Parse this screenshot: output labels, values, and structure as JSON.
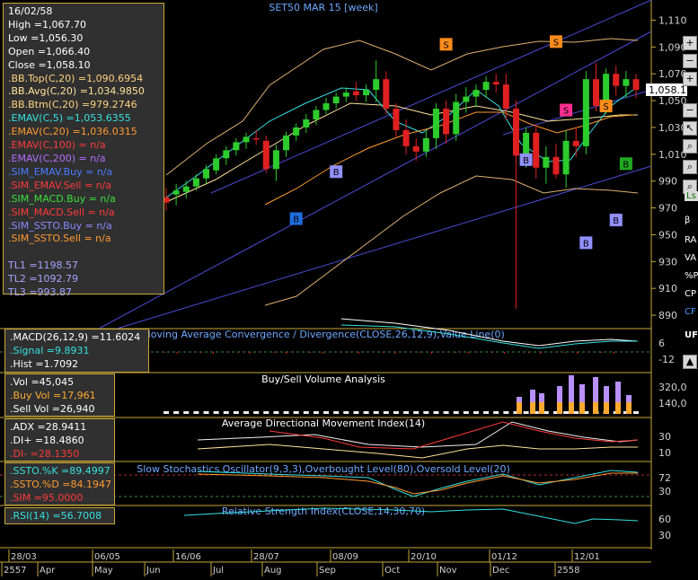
{
  "title": "SET50 MAR 15  [week]",
  "chart_data": {
    "type": "candlestick",
    "title": "SET50 MAR 15  [week]",
    "x_labels": [
      "28/03",
      "06/05",
      "16/06",
      "28/07",
      "08/09",
      "20/10",
      "01/12",
      "12/01"
    ],
    "month_labels": [
      "2557",
      "Apr",
      "May",
      "Jun",
      "Jul",
      "Aug",
      "Sep",
      "Oct",
      "Nov",
      "Dec",
      "2558"
    ],
    "y_ticks": [
      1110,
      1090,
      1070,
      1050,
      1030,
      1010,
      990,
      970,
      950,
      930,
      910,
      890
    ],
    "ylim": [
      880,
      1117
    ],
    "current_price": "1,058.1",
    "candles": [
      {
        "o": 978,
        "h": 985,
        "l": 968,
        "c": 974
      },
      {
        "o": 980,
        "h": 988,
        "l": 972,
        "c": 983
      },
      {
        "o": 982,
        "h": 990,
        "l": 977,
        "c": 986
      },
      {
        "o": 986,
        "h": 995,
        "l": 983,
        "c": 992
      },
      {
        "o": 992,
        "h": 1002,
        "l": 988,
        "c": 999
      },
      {
        "o": 998,
        "h": 1010,
        "l": 995,
        "c": 1007
      },
      {
        "o": 1007,
        "h": 1016,
        "l": 1002,
        "c": 1013
      },
      {
        "o": 1013,
        "h": 1022,
        "l": 1009,
        "c": 1019
      },
      {
        "o": 1019,
        "h": 1026,
        "l": 1014,
        "c": 1023
      },
      {
        "o": 1022,
        "h": 1028,
        "l": 1017,
        "c": 1021
      },
      {
        "o": 1020,
        "h": 1024,
        "l": 996,
        "c": 999
      },
      {
        "o": 999,
        "h": 1017,
        "l": 990,
        "c": 1013
      },
      {
        "o": 1013,
        "h": 1027,
        "l": 1008,
        "c": 1024
      },
      {
        "o": 1024,
        "h": 1033,
        "l": 1020,
        "c": 1030
      },
      {
        "o": 1030,
        "h": 1040,
        "l": 1026,
        "c": 1036
      },
      {
        "o": 1036,
        "h": 1046,
        "l": 1032,
        "c": 1043
      },
      {
        "o": 1043,
        "h": 1052,
        "l": 1040,
        "c": 1048
      },
      {
        "o": 1048,
        "h": 1056,
        "l": 1044,
        "c": 1053
      },
      {
        "o": 1053,
        "h": 1060,
        "l": 1049,
        "c": 1056
      },
      {
        "o": 1057,
        "h": 1064,
        "l": 1050,
        "c": 1054
      },
      {
        "o": 1054,
        "h": 1062,
        "l": 1049,
        "c": 1058
      },
      {
        "o": 1058,
        "h": 1080,
        "l": 1049,
        "c": 1066
      },
      {
        "o": 1066,
        "h": 1072,
        "l": 1040,
        "c": 1044
      },
      {
        "o": 1044,
        "h": 1048,
        "l": 1023,
        "c": 1028
      },
      {
        "o": 1028,
        "h": 1036,
        "l": 1010,
        "c": 1016
      },
      {
        "o": 1016,
        "h": 1022,
        "l": 1005,
        "c": 1012
      },
      {
        "o": 1012,
        "h": 1028,
        "l": 1008,
        "c": 1022
      },
      {
        "o": 1022,
        "h": 1048,
        "l": 1014,
        "c": 1044
      },
      {
        "o": 1044,
        "h": 1050,
        "l": 1018,
        "c": 1025
      },
      {
        "o": 1025,
        "h": 1055,
        "l": 1020,
        "c": 1049
      },
      {
        "o": 1049,
        "h": 1060,
        "l": 1041,
        "c": 1053
      },
      {
        "o": 1053,
        "h": 1062,
        "l": 1045,
        "c": 1058
      },
      {
        "o": 1058,
        "h": 1068,
        "l": 1053,
        "c": 1064
      },
      {
        "o": 1064,
        "h": 1070,
        "l": 1056,
        "c": 1062
      },
      {
        "o": 1062,
        "h": 1070,
        "l": 1036,
        "c": 1044
      },
      {
        "o": 1044,
        "h": 1050,
        "l": 895,
        "c": 1009
      },
      {
        "o": 1009,
        "h": 1030,
        "l": 1000,
        "c": 1026
      },
      {
        "o": 1026,
        "h": 1032,
        "l": 992,
        "c": 1000
      },
      {
        "o": 1000,
        "h": 1016,
        "l": 988,
        "c": 1008
      },
      {
        "o": 1008,
        "h": 1018,
        "l": 992,
        "c": 995
      },
      {
        "o": 995,
        "h": 1028,
        "l": 985,
        "c": 1020
      },
      {
        "o": 1020,
        "h": 1030,
        "l": 1008,
        "c": 1016
      },
      {
        "o": 1016,
        "h": 1072,
        "l": 1010,
        "c": 1066
      },
      {
        "o": 1066,
        "h": 1078,
        "l": 1042,
        "c": 1046
      },
      {
        "o": 1046,
        "h": 1074,
        "l": 1040,
        "c": 1070
      },
      {
        "o": 1070,
        "h": 1076,
        "l": 1054,
        "c": 1061
      },
      {
        "o": 1061,
        "h": 1072,
        "l": 1052,
        "c": 1066
      },
      {
        "o": 1066,
        "h": 1070,
        "l": 1052,
        "c": 1058
      }
    ],
    "signals": [
      {
        "i": 13,
        "label": "B",
        "price": 962,
        "color": "#1e6fe0"
      },
      {
        "i": 17,
        "label": "B",
        "price": 997,
        "color": "#9090ff"
      },
      {
        "i": 28,
        "label": "S",
        "price": 1092,
        "color": "#ff8c1a"
      },
      {
        "i": 36,
        "label": "B",
        "price": 1006,
        "color": "#9090ff"
      },
      {
        "i": 39,
        "label": "S",
        "price": 1094,
        "color": "#ff8c1a"
      },
      {
        "i": 40,
        "label": "S",
        "price": 1043,
        "color": "#ff3090"
      },
      {
        "i": 42,
        "label": "B",
        "price": 944,
        "color": "#9090ff"
      },
      {
        "i": 44,
        "label": "S",
        "price": 1046,
        "color": "#ff8c1a"
      },
      {
        "i": 45,
        "label": "B",
        "price": 961,
        "color": "#9090ff"
      },
      {
        "i": 46,
        "label": "B",
        "price": 1003,
        "color": "#1faa1f"
      }
    ]
  },
  "info_main": [
    {
      "text": "16/02/58",
      "color": "#ffffff"
    },
    {
      "text": "High  =1,067.70",
      "color": "#ffffff"
    },
    {
      "text": "Low  =1,056.30",
      "color": "#ffffff"
    },
    {
      "text": "Open  =1,066.40",
      "color": "#ffffff"
    },
    {
      "text": "Close  =1,058.10",
      "color": "#ffffff"
    },
    {
      "text": ".BB.Top(C,20)  =1,090.6954",
      "color": "#ffd27f"
    },
    {
      "text": ".BB.Avg(C,20)  =1,034.9850",
      "color": "#ffe39a"
    },
    {
      "text": ".BB.Btm(C,20)  =979.2746",
      "color": "#ffd27f"
    },
    {
      "text": ".EMAV(C,5)  =1,053.6355",
      "color": "#36e0e0"
    },
    {
      "text": ".EMAV(C,20)  =1,036.0315",
      "color": "#ff9a30"
    },
    {
      "text": ".EMAV(C,100)  = n/a",
      "color": "#ff3a3a"
    },
    {
      "text": ".EMAV(C,200)  = n/a",
      "color": "#b46cff"
    },
    {
      "text": ".SIM_EMAV.Buy  = n/a",
      "color": "#4a7bff"
    },
    {
      "text": ".SIM_EMAV.Sell  = n/a",
      "color": "#ff3a3a"
    },
    {
      "text": ".SIM_MACD.Buy  = n/a",
      "color": "#39e039"
    },
    {
      "text": ".SIM_MACD.Sell  = n/a",
      "color": "#ff3a3a"
    },
    {
      "text": ".SIM_SSTO.Buy  = n/a",
      "color": "#8a8aff"
    },
    {
      "text": ".SIM_SSTO.Sell  = n/a",
      "color": "#ff9a30"
    },
    {
      "text": "",
      "color": "#ffffff"
    },
    {
      "text": "TL1 =1198.57",
      "color": "#a4a4ff"
    },
    {
      "text": "TL2 =1092.79",
      "color": "#a4a4ff"
    },
    {
      "text": "TL3 =993.87",
      "color": "#a4a4ff"
    }
  ],
  "macd": {
    "title": "Moving Average Convergence / Divergence(CLOSE,26,12,9),Value Line(0)",
    "rows": [
      {
        "text": ".MACD(26,12,9)  =11.6024",
        "color": "#ffffff"
      },
      {
        "text": ".Signal  =9.8931",
        "color": "#36e0e0"
      },
      {
        "text": ".Hist  =1.7092",
        "color": "#ffffff"
      }
    ],
    "ticks": [
      {
        "v": "6"
      },
      {
        "v": "-12"
      }
    ]
  },
  "volume": {
    "title": "Buy/Sell Volume Analysis",
    "rows": [
      {
        "text": ".Vol  =45,045",
        "color": "#ffffff"
      },
      {
        "text": ".Buy Vol  =17,961",
        "color": "#ffaa30"
      },
      {
        "text": ".Sell Vol  =26,940",
        "color": "#ffffff"
      }
    ],
    "ticks": [
      {
        "v": "320,0"
      },
      {
        "v": "140,0"
      }
    ]
  },
  "adx": {
    "title": "Average Directional Movement Index(14)",
    "rows": [
      {
        "text": ".ADX  =28.9411",
        "color": "#ffffff"
      },
      {
        "text": ".DI+  =18.4860",
        "color": "#ffffff"
      },
      {
        "text": ".DI-  =28.1350",
        "color": "#ff3a3a"
      }
    ],
    "ticks": [
      {
        "v": "30"
      },
      {
        "v": "10"
      }
    ]
  },
  "ssto": {
    "title": "Slow Stochastics Oscillator(9,3,3),Overbought Level(80),Oversold Level(20)",
    "rows": [
      {
        "text": ".SSTO.%K  =89.4997",
        "color": "#36e0e0"
      },
      {
        "text": ".SSTO.%D  =84.1947",
        "color": "#ff9a30"
      },
      {
        "text": ".SIM  =95.0000",
        "color": "#ff3a3a"
      }
    ],
    "ticks": [
      {
        "v": "72"
      },
      {
        "v": "30"
      }
    ]
  },
  "rsi": {
    "title": "Relative Strength Index(CLOSE,14,30,70)",
    "rows": [
      {
        "text": ".RSI(14)  =56.7008",
        "color": "#36e0e0"
      }
    ],
    "ticks": [
      {
        "v": "60"
      },
      {
        "v": "30"
      }
    ]
  },
  "toolbar": {
    "items": [
      {
        "name": "zoom-in-icon",
        "text": "+"
      },
      {
        "name": "zoom-out-icon",
        "text": "−"
      },
      {
        "name": "plus-icon",
        "text": "+"
      },
      {
        "name": "minus-icon",
        "text": "−"
      },
      {
        "name": "arrow-left-icon",
        "text": "↖"
      },
      {
        "name": "search-icon",
        "text": "⌕"
      },
      {
        "name": "search-plus-icon",
        "text": "⌕"
      },
      {
        "name": "search-minus-icon",
        "text": "⌕"
      }
    ],
    "labels": [
      "Ls",
      "β",
      "RA",
      "VA",
      "%P",
      "CP",
      "CF",
      "UF"
    ]
  }
}
